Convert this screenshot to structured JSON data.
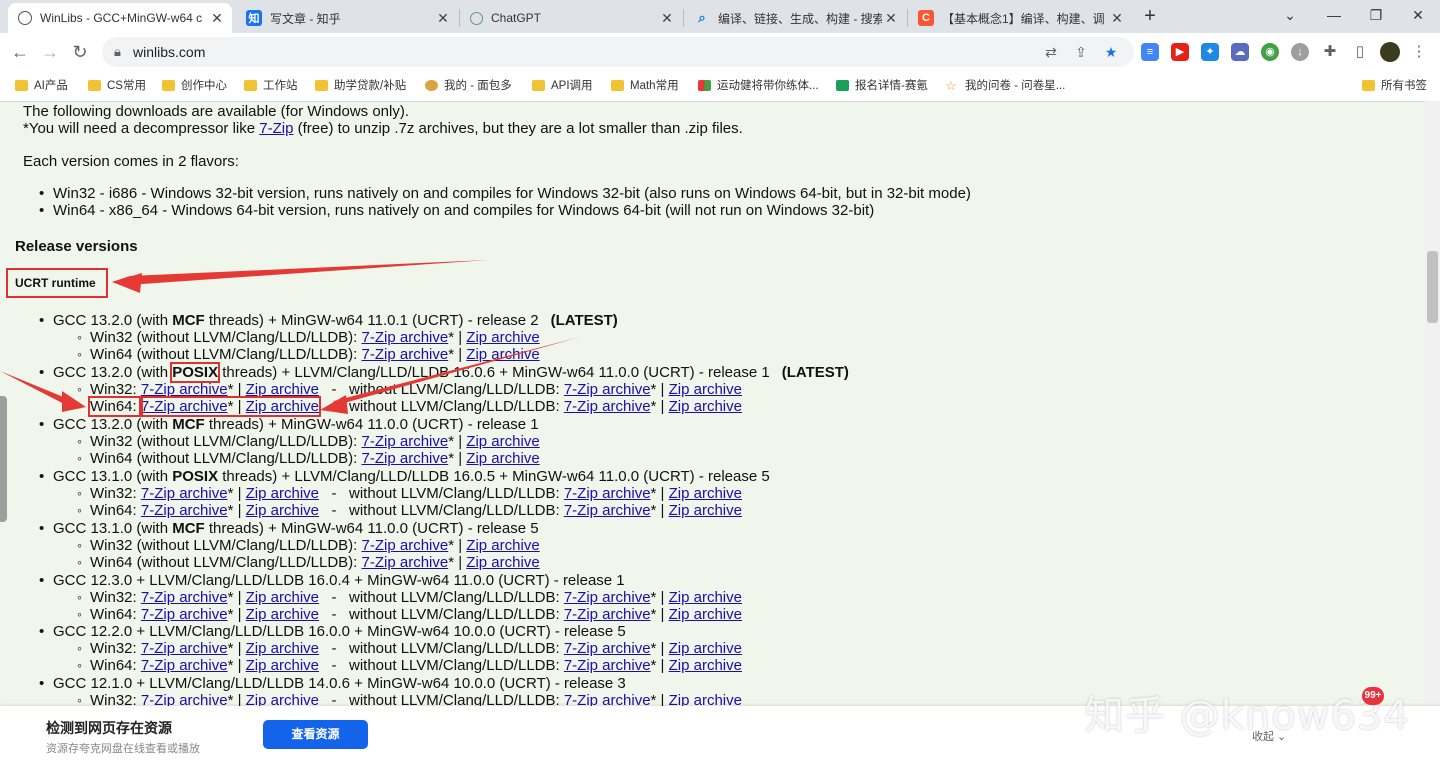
{
  "tabs": [
    {
      "title": "WinLibs - GCC+MinGW-w64 c",
      "favicon": "winlibs-icon"
    },
    {
      "title": "写文章 - 知乎",
      "favicon": "zhihu-icon",
      "favicon_text": "知"
    },
    {
      "title": "ChatGPT",
      "favicon": "chatgpt-icon"
    },
    {
      "title": "编译、链接、生成、构建 - 搜索",
      "favicon": "search-icon"
    },
    {
      "title": "【基本概念1】编译、构建、调",
      "favicon": "csdn-icon",
      "favicon_text": "C"
    }
  ],
  "address": {
    "url": "winlibs.com"
  },
  "bookmarks": [
    {
      "label": "AI产品",
      "icon": "folder-icon"
    },
    {
      "label": "CS常用",
      "icon": "folder-icon"
    },
    {
      "label": "创作中心",
      "icon": "folder-icon"
    },
    {
      "label": "工作站",
      "icon": "folder-icon"
    },
    {
      "label": "助学贷款/补贴",
      "icon": "folder-icon"
    },
    {
      "label": "我的 - 面包多",
      "icon": "site-icon"
    },
    {
      "label": "API调用",
      "icon": "folder-icon"
    },
    {
      "label": "Math常用",
      "icon": "folder-icon"
    },
    {
      "label": "运动健将带你练体...",
      "icon": "grid-icon"
    },
    {
      "label": "报名详情-赛氪",
      "icon": "dollar-icon"
    },
    {
      "label": "我的问卷 - 问卷星...",
      "icon": "star-icon"
    },
    {
      "label": "所有书签",
      "icon": "folder-icon"
    }
  ],
  "page": {
    "intro1": "The following downloads are available (for Windows only).",
    "intro2_a": "*You will need a decompressor like ",
    "intro2_link": "7-Zip",
    "intro2_b": " (free) to unzip .7z archives, but they are a lot smaller than .zip files.",
    "flavors_heading": "Each version comes in 2 flavors:",
    "flavor1": "Win32 - i686 - Windows 32-bit version, runs natively on and compiles for Windows 32-bit (also runs on Windows 64-bit, but in 32-bit mode)",
    "flavor2": "Win64 - x86_64 - Windows 64-bit version, runs natively on and compiles for Windows 64-bit (will not run on Windows 32-bit)",
    "release_heading": "Release versions",
    "ucrt_heading": "UCRT runtime",
    "zip7": "7-Zip archive",
    "zip": "Zip archive",
    "star": "*",
    "pipe": " | ",
    "dash": "   -   ",
    "without": "without LLVM/Clang/LLD/LLDB: ",
    "win32_colon": "Win32: ",
    "win64_colon": "Win64: ",
    "win32_without": "Win32 (without LLVM/Clang/LLD/LLDB): ",
    "win64_without": "Win64 (without LLVM/Clang/LLD/LLDB): ",
    "latest": "(LATEST)",
    "gcc1_a": "GCC 13.2.0 (with ",
    "gcc1_b": "MCF",
    "gcc1_c": " threads) + MinGW-w64 11.0.1 (UCRT) - release 2",
    "gcc2_a": "GCC 13.2.0 (with ",
    "gcc2_b": "POSIX",
    "gcc2_c": " threads) + LLVM/Clang/LLD/LLDB 16.0.6 + MinGW-w64 11.0.0 (UCRT) - release 1",
    "gcc3_a": "GCC 13.2.0 (with ",
    "gcc3_b": "MCF",
    "gcc3_c": " threads) + MinGW-w64 11.0.0 (UCRT) - release 1",
    "gcc4_a": "GCC 13.1.0 (with ",
    "gcc4_b": "POSIX",
    "gcc4_c": " threads) + LLVM/Clang/LLD/LLDB 16.0.5 + MinGW-w64 11.0.0 (UCRT) - release 5",
    "gcc5_a": "GCC 13.1.0 (with ",
    "gcc5_b": "MCF",
    "gcc5_c": " threads) + MinGW-w64 11.0.0 (UCRT) - release 5",
    "gcc6": "GCC 12.3.0 + LLVM/Clang/LLD/LLDB 16.0.4 + MinGW-w64 11.0.0 (UCRT) - release 1",
    "gcc7": "GCC 12.2.0 + LLVM/Clang/LLD/LLDB 16.0.0 + MinGW-w64 10.0.0 (UCRT) - release 5",
    "gcc8": "GCC 12.1.0 + LLVM/Clang/LLD/LLDB 14.0.6 + MinGW-w64 10.0.0 (UCRT) - release 3"
  },
  "banner": {
    "title": "检测到网页存在资源",
    "subtitle": "资源存夸克网盘在线查看或播放",
    "button": "查看资源",
    "collapse": "收起 ⌄"
  },
  "watermark": "知乎 @know634",
  "badge": "99+",
  "colors": {
    "annotation": "#e03131",
    "link": "#1a0dab",
    "page_bg": "#f0f6eb",
    "banner_button": "#1463eb"
  }
}
